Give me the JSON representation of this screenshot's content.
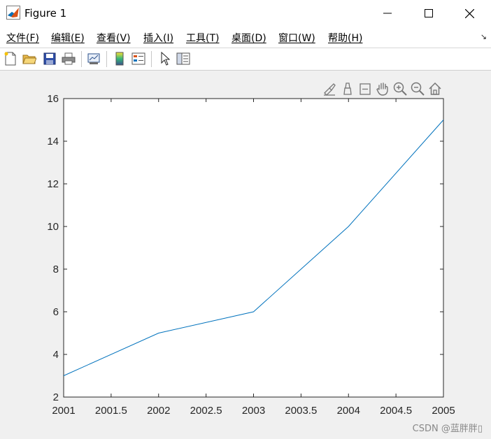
{
  "window": {
    "title": "Figure 1"
  },
  "menu": {
    "items": [
      {
        "label": "文件(F)"
      },
      {
        "label": "编辑(E)"
      },
      {
        "label": "查看(V)"
      },
      {
        "label": "插入(I)"
      },
      {
        "label": "工具(T)"
      },
      {
        "label": "桌面(D)"
      },
      {
        "label": "窗口(W)"
      },
      {
        "label": "帮助(H)"
      }
    ]
  },
  "toolbar": {
    "tools": [
      "new-figure-icon",
      "open-file-icon",
      "save-icon",
      "print-icon",
      "link-plot-icon",
      "colorbar-icon",
      "legend-icon",
      "pointer-icon",
      "property-inspector-icon"
    ]
  },
  "axes_toolbar": {
    "tools": [
      "brush-icon",
      "data-tips-icon",
      "datatip-icon",
      "pan-icon",
      "zoom-in-icon",
      "zoom-out-icon",
      "home-icon"
    ]
  },
  "chart_data": {
    "type": "line",
    "x": [
      2001,
      2002,
      2003,
      2004,
      2005
    ],
    "series": [
      {
        "values": [
          3,
          5,
          6,
          10,
          15
        ],
        "color": "#0072bd"
      }
    ],
    "xlim": [
      2001,
      2005
    ],
    "ylim": [
      2,
      16
    ],
    "xticks": [
      "2001",
      "2001.5",
      "2002",
      "2002.5",
      "2003",
      "2003.5",
      "2004",
      "2004.5",
      "2005"
    ],
    "yticks": [
      "2",
      "4",
      "6",
      "8",
      "10",
      "12",
      "14",
      "16"
    ],
    "grid": false
  },
  "watermark": "CSDN @蓝胖胖▯"
}
